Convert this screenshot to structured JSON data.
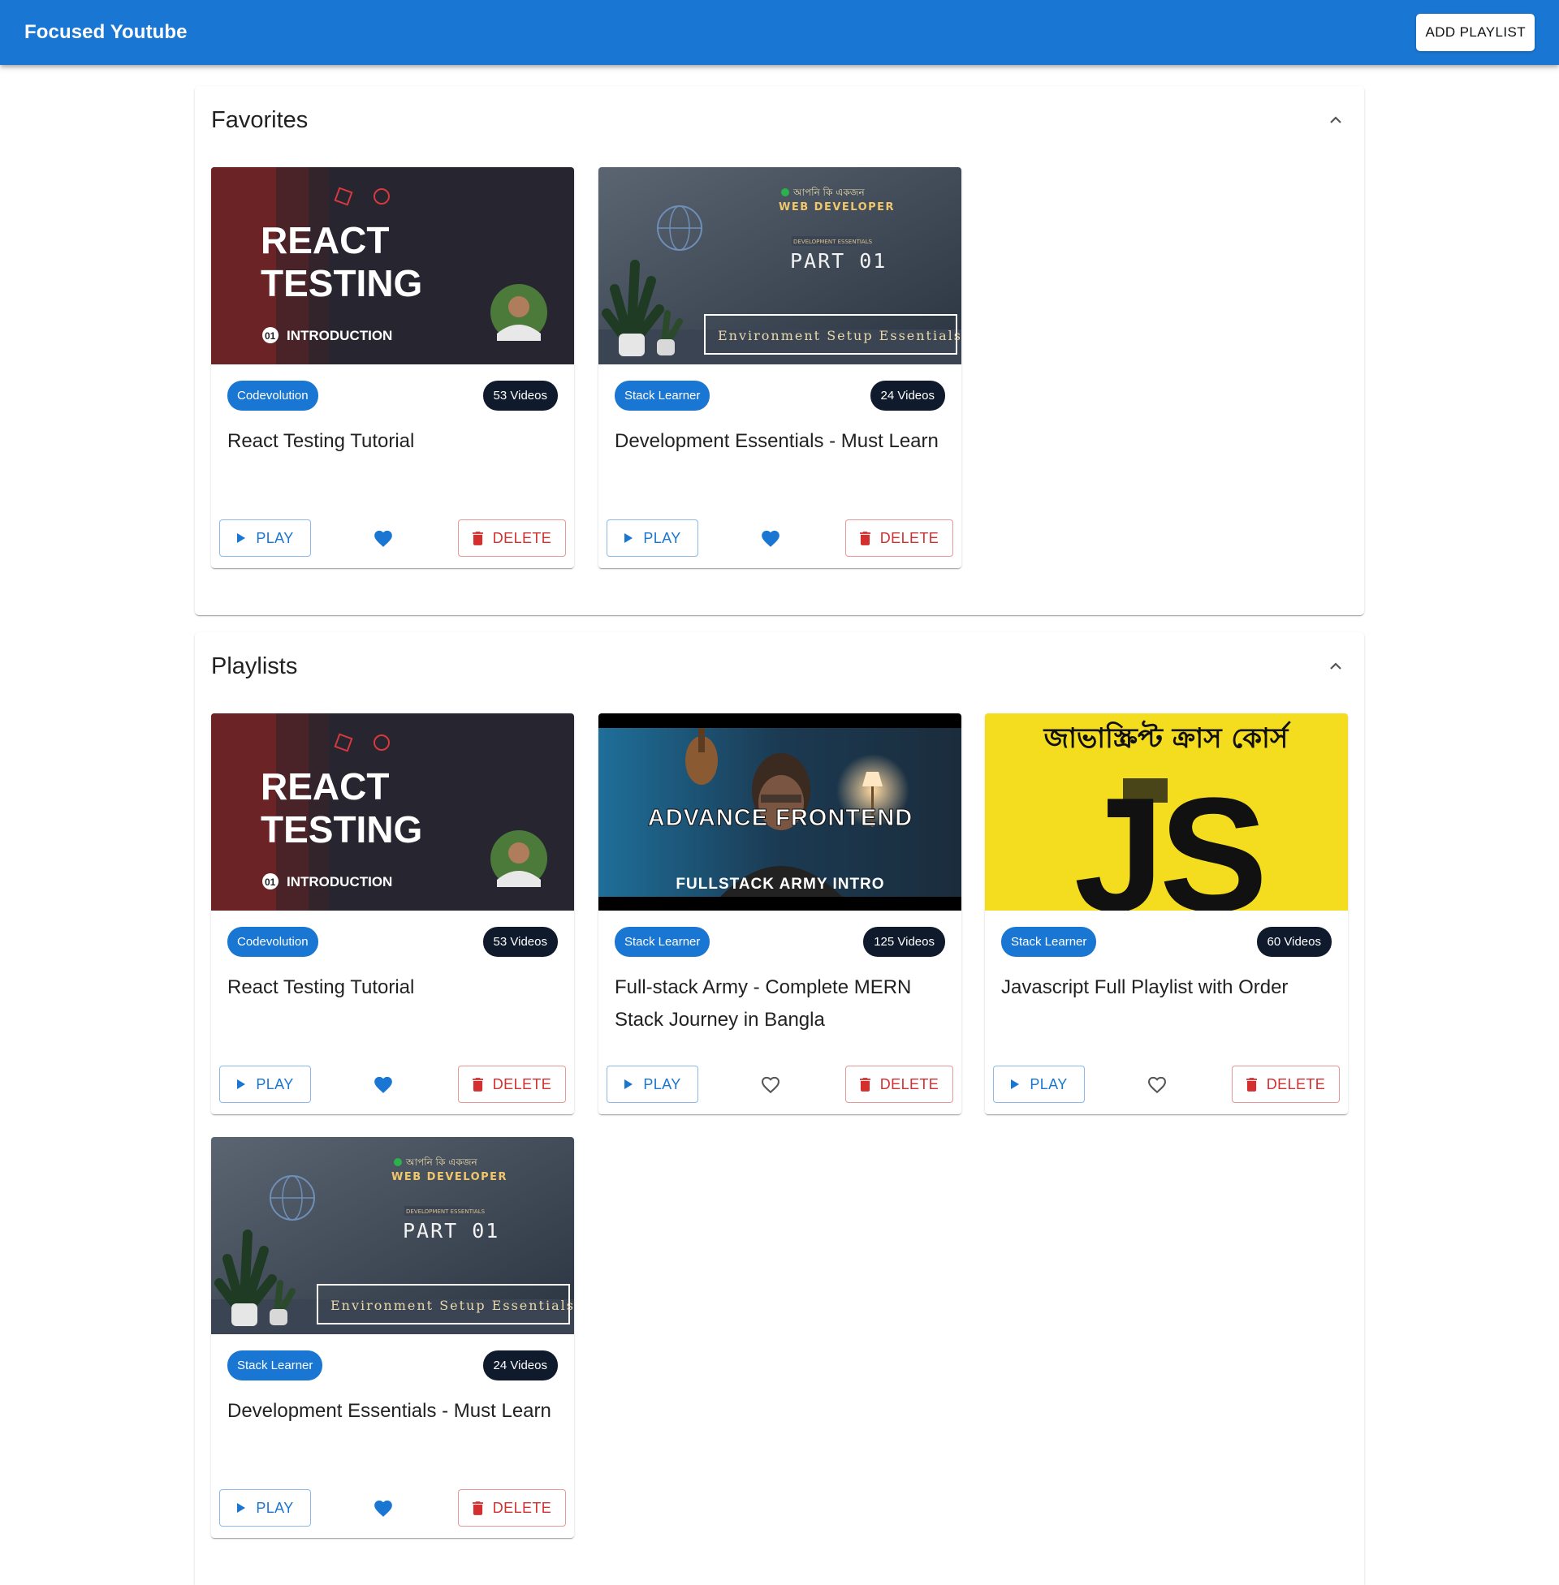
{
  "app": {
    "title": "Focused Youtube",
    "add_label": "ADD PLAYLIST"
  },
  "colors": {
    "primary": "#1976d2",
    "danger": "#d32f2f",
    "count_chip": "#0f1b2d"
  },
  "favorites": {
    "title": "Favorites",
    "cards": [
      {
        "channel": "Codevolution",
        "count": "53 Videos",
        "title": "React Testing Tutorial",
        "favorite": true,
        "play": "PLAY",
        "delete": "DELETE",
        "thumb": {
          "line1": "REACT",
          "line2": "TESTING",
          "badge": "01",
          "sub": "INTRODUCTION"
        }
      },
      {
        "channel": "Stack Learner",
        "count": "24 Videos",
        "title": "Development Essentials - Must Learn",
        "favorite": true,
        "play": "PLAY",
        "delete": "DELETE",
        "thumb": {
          "top": "আপনি কি একজন",
          "role": "WEB DEVELOPER",
          "small": "DEVELOPMENT ESSENTIALS",
          "part": "PART 01",
          "box": "Environment Setup Essentials"
        }
      }
    ]
  },
  "playlists": {
    "title": "Playlists",
    "cards": [
      {
        "channel": "Codevolution",
        "count": "53 Videos",
        "title": "React Testing Tutorial",
        "favorite": true,
        "play": "PLAY",
        "delete": "DELETE",
        "thumb": {
          "line1": "REACT",
          "line2": "TESTING",
          "badge": "01",
          "sub": "INTRODUCTION"
        }
      },
      {
        "channel": "Stack Learner",
        "count": "125 Videos",
        "title": "Full-stack Army - Complete MERN Stack Journey in Bangla",
        "favorite": false,
        "play": "PLAY",
        "delete": "DELETE",
        "thumb": {
          "headline": "ADVANCE FRONTEND",
          "sub": "FULLSTACK ARMY INTRO"
        }
      },
      {
        "channel": "Stack Learner",
        "count": "60 Videos",
        "title": "Javascript Full Playlist with Order",
        "favorite": false,
        "play": "PLAY",
        "delete": "DELETE",
        "thumb": {
          "top": "জাভাস্ক্রিপ্ট ক্রাস কোর্স",
          "big": "JS"
        }
      },
      {
        "channel": "Stack Learner",
        "count": "24 Videos",
        "title": "Development Essentials - Must Learn",
        "favorite": true,
        "play": "PLAY",
        "delete": "DELETE",
        "thumb": {
          "top": "আপনি কি একজন",
          "role": "WEB DEVELOPER",
          "small": "DEVELOPMENT ESSENTIALS",
          "part": "PART 01",
          "box": "Environment Setup Essentials"
        }
      }
    ]
  }
}
